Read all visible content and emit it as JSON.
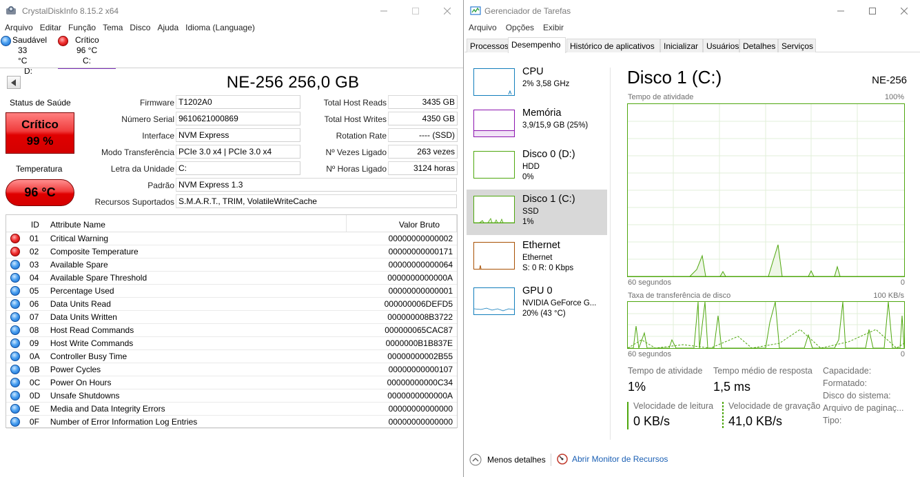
{
  "cdi": {
    "title": "CrystalDiskInfo 8.15.2 x64",
    "menu": [
      "Arquivo",
      "Editar",
      "Função",
      "Tema",
      "Disco",
      "Ajuda",
      "Idioma (Language)"
    ],
    "drives": [
      {
        "status": "Saudável",
        "temp": "33 °C",
        "letter": "D:"
      },
      {
        "status": "Crítico",
        "temp": "96 °C",
        "letter": "C:"
      }
    ],
    "model": "NE-256 256,0 GB",
    "health_label": "Status de Saúde",
    "health_status": "Crítico",
    "health_percent": "99 %",
    "temp_label": "Temperatura",
    "temp_value": "96 °C",
    "info_left": [
      {
        "label": "Firmware",
        "value": "T1202A0"
      },
      {
        "label": "Número Serial",
        "value": "9610621000869"
      },
      {
        "label": "Interface",
        "value": "NVM Express"
      },
      {
        "label": "Modo Transferência",
        "value": "PCIe 3.0 x4 | PCIe 3.0 x4"
      },
      {
        "label": "Letra da Unidade",
        "value": "C:"
      },
      {
        "label": "Padrão",
        "value": "NVM Express 1.3"
      },
      {
        "label": "Recursos Suportados",
        "value": "S.M.A.R.T., TRIM, VolatileWriteCache"
      }
    ],
    "info_right": [
      {
        "label": "Total Host Reads",
        "value": "3435 GB"
      },
      {
        "label": "Total Host Writes",
        "value": "4350 GB"
      },
      {
        "label": "Rotation Rate",
        "value": "---- (SSD)"
      },
      {
        "label": "Nº Vezes Ligado",
        "value": "263 vezes"
      },
      {
        "label": "Nº Horas Ligado",
        "value": "3124 horas"
      }
    ],
    "smart_headers": {
      "id": "ID",
      "name": "Attribute Name",
      "raw": "Valor Bruto"
    },
    "smart_rows": [
      {
        "status": "red",
        "id": "01",
        "name": "Critical Warning",
        "raw": "00000000000002"
      },
      {
        "status": "red",
        "id": "02",
        "name": "Composite Temperature",
        "raw": "00000000000171"
      },
      {
        "status": "blue",
        "id": "03",
        "name": "Available Spare",
        "raw": "00000000000064"
      },
      {
        "status": "blue",
        "id": "04",
        "name": "Available Spare Threshold",
        "raw": "0000000000000A"
      },
      {
        "status": "blue",
        "id": "05",
        "name": "Percentage Used",
        "raw": "00000000000001"
      },
      {
        "status": "blue",
        "id": "06",
        "name": "Data Units Read",
        "raw": "000000006DEFD5"
      },
      {
        "status": "blue",
        "id": "07",
        "name": "Data Units Written",
        "raw": "000000008B3722"
      },
      {
        "status": "blue",
        "id": "08",
        "name": "Host Read Commands",
        "raw": "000000065CAC87"
      },
      {
        "status": "blue",
        "id": "09",
        "name": "Host Write Commands",
        "raw": "0000000B1B837E"
      },
      {
        "status": "blue",
        "id": "0A",
        "name": "Controller Busy Time",
        "raw": "00000000002B55"
      },
      {
        "status": "blue",
        "id": "0B",
        "name": "Power Cycles",
        "raw": "00000000000107"
      },
      {
        "status": "blue",
        "id": "0C",
        "name": "Power On Hours",
        "raw": "00000000000C34"
      },
      {
        "status": "blue",
        "id": "0D",
        "name": "Unsafe Shutdowns",
        "raw": "0000000000000A"
      },
      {
        "status": "blue",
        "id": "0E",
        "name": "Media and Data Integrity Errors",
        "raw": "00000000000000"
      },
      {
        "status": "blue",
        "id": "0F",
        "name": "Number of Error Information Log Entries",
        "raw": "00000000000000"
      }
    ],
    "colors": {
      "critical": "#e00000",
      "healthy": "#1a73d9",
      "selected_tab": "#7a2fb8"
    }
  },
  "tm": {
    "title": "Gerenciador de Tarefas",
    "menu": [
      "Arquivo",
      "Opções",
      "Exibir"
    ],
    "tabs": [
      "Processos",
      "Desempenho",
      "Histórico de aplicativos",
      "Inicializar",
      "Usuários",
      "Detalhes",
      "Serviços"
    ],
    "active_tab": "Desempenho",
    "sidebar": [
      {
        "title": "CPU",
        "line1": "2% 3,58 GHz",
        "line2": "",
        "color": "#117dbb"
      },
      {
        "title": "Memória",
        "line1": "3,9/15,9 GB (25%)",
        "line2": "",
        "color": "#8b12ae"
      },
      {
        "title": "Disco 0 (D:)",
        "line1": "HDD",
        "line2": "0%",
        "color": "#4da60c"
      },
      {
        "title": "Disco 1 (C:)",
        "line1": "SSD",
        "line2": "1%",
        "color": "#4da60c"
      },
      {
        "title": "Ethernet",
        "line1": "Ethernet",
        "line2": "S: 0 R: 0 Kbps",
        "color": "#a74f01"
      },
      {
        "title": "GPU 0",
        "line1": "NVIDIA GeForce G...",
        "line2": "20% (43 °C)",
        "color": "#117dbb"
      }
    ],
    "disk_title": "Disco 1 (C:)",
    "disk_model": "NE-256",
    "graph1": {
      "label": "Tempo de atividade",
      "max": "100%",
      "xlabel": "60 segundos",
      "xmin": "0"
    },
    "graph2": {
      "label": "Taxa de transferência de disco",
      "max": "100 KB/s",
      "xlabel": "60 segundos",
      "xmin": "0"
    },
    "stats": {
      "activity_label": "Tempo de atividade",
      "activity_value": "1%",
      "response_label": "Tempo médio de resposta",
      "response_value": "1,5 ms",
      "read_label": "Velocidade de leitura",
      "read_value": "0 KB/s",
      "write_label": "Velocidade de gravação",
      "write_value": "41,0 KB/s"
    },
    "details": [
      "Capacidade:",
      "Formatado:",
      "Disco do sistema:",
      "Arquivo de paginaç...",
      "Tipo:"
    ],
    "footer": {
      "less_details": "Menos detalhes",
      "resource_monitor": "Abrir Monitor de Recursos"
    }
  }
}
